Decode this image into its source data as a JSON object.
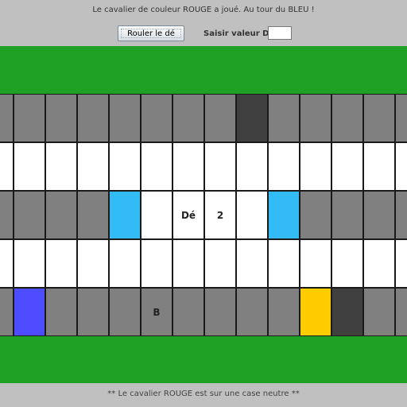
{
  "header": {
    "status_message": "Le cavalier de couleur ROUGE a joué.  Au tour du BLEU !",
    "roll_button_label": "Rouler le dé",
    "dice_value_label": "Saisir valeur Dé :",
    "dice_value_input": ""
  },
  "footer": {
    "status_message": "** Le cavalier ROUGE est sur une case neutre **"
  },
  "colors": {
    "zone_green": "#1fa224",
    "square_gray": "#808080",
    "square_white": "#ffffff",
    "square_dark": "#404040",
    "square_cyan": "#33bbf5",
    "knight_blue": "#4d4dff",
    "square_yellow": "#ffcc00"
  },
  "board": {
    "rows": [
      {
        "cells": [
          {
            "color": "gray",
            "text": ""
          },
          {
            "color": "gray",
            "text": ""
          },
          {
            "color": "gray",
            "text": ""
          },
          {
            "color": "gray",
            "text": ""
          },
          {
            "color": "gray",
            "text": ""
          },
          {
            "color": "gray",
            "text": ""
          },
          {
            "color": "gray",
            "text": ""
          },
          {
            "color": "gray",
            "text": ""
          },
          {
            "color": "dark",
            "text": ""
          },
          {
            "color": "gray",
            "text": ""
          },
          {
            "color": "gray",
            "text": ""
          },
          {
            "color": "gray",
            "text": ""
          },
          {
            "color": "gray",
            "text": ""
          },
          {
            "color": "gray",
            "text": ""
          }
        ]
      },
      {
        "cells": [
          {
            "color": "white",
            "text": ""
          },
          {
            "color": "white",
            "text": ""
          },
          {
            "color": "white",
            "text": ""
          },
          {
            "color": "white",
            "text": ""
          },
          {
            "color": "white",
            "text": ""
          },
          {
            "color": "white",
            "text": ""
          },
          {
            "color": "white",
            "text": ""
          },
          {
            "color": "white",
            "text": ""
          },
          {
            "color": "white",
            "text": ""
          },
          {
            "color": "white",
            "text": ""
          },
          {
            "color": "white",
            "text": ""
          },
          {
            "color": "white",
            "text": ""
          },
          {
            "color": "white",
            "text": ""
          },
          {
            "color": "white",
            "text": ""
          }
        ]
      },
      {
        "cells": [
          {
            "color": "gray",
            "text": ""
          },
          {
            "color": "gray",
            "text": ""
          },
          {
            "color": "gray",
            "text": ""
          },
          {
            "color": "gray",
            "text": ""
          },
          {
            "color": "cyan",
            "text": ""
          },
          {
            "color": "white",
            "text": ""
          },
          {
            "color": "white",
            "text": "Dé"
          },
          {
            "color": "white",
            "text": "2"
          },
          {
            "color": "white",
            "text": ""
          },
          {
            "color": "cyan",
            "text": ""
          },
          {
            "color": "gray",
            "text": ""
          },
          {
            "color": "gray",
            "text": ""
          },
          {
            "color": "gray",
            "text": ""
          },
          {
            "color": "gray",
            "text": ""
          }
        ]
      },
      {
        "cells": [
          {
            "color": "white",
            "text": ""
          },
          {
            "color": "white",
            "text": ""
          },
          {
            "color": "white",
            "text": ""
          },
          {
            "color": "white",
            "text": ""
          },
          {
            "color": "white",
            "text": ""
          },
          {
            "color": "white",
            "text": ""
          },
          {
            "color": "white",
            "text": ""
          },
          {
            "color": "white",
            "text": ""
          },
          {
            "color": "white",
            "text": ""
          },
          {
            "color": "white",
            "text": ""
          },
          {
            "color": "white",
            "text": ""
          },
          {
            "color": "white",
            "text": ""
          },
          {
            "color": "white",
            "text": ""
          },
          {
            "color": "white",
            "text": ""
          }
        ]
      },
      {
        "cells": [
          {
            "color": "gray",
            "text": ""
          },
          {
            "color": "blue",
            "text": ""
          },
          {
            "color": "gray",
            "text": ""
          },
          {
            "color": "gray",
            "text": ""
          },
          {
            "color": "gray",
            "text": ""
          },
          {
            "color": "gray",
            "text": "B"
          },
          {
            "color": "gray",
            "text": ""
          },
          {
            "color": "gray",
            "text": ""
          },
          {
            "color": "gray",
            "text": ""
          },
          {
            "color": "gray",
            "text": ""
          },
          {
            "color": "yellow",
            "text": ""
          },
          {
            "color": "dark",
            "text": ""
          },
          {
            "color": "gray",
            "text": ""
          },
          {
            "color": "gray",
            "text": ""
          }
        ]
      }
    ]
  }
}
